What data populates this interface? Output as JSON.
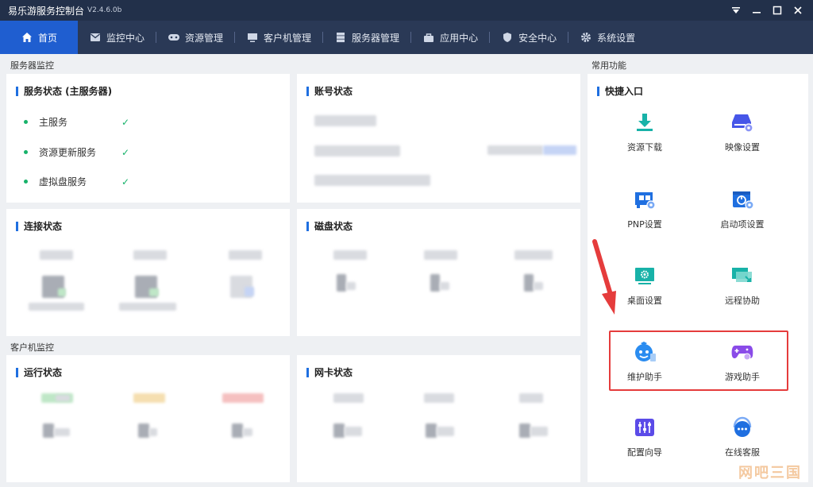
{
  "window": {
    "title": "易乐游服务控制台",
    "version": "V2.4.6.0b"
  },
  "nav": [
    {
      "label": "首页",
      "icon": "home-icon"
    },
    {
      "label": "监控中心",
      "icon": "monitor-mail-icon"
    },
    {
      "label": "资源管理",
      "icon": "gamepad-icon"
    },
    {
      "label": "客户机管理",
      "icon": "computer-icon"
    },
    {
      "label": "服务器管理",
      "icon": "server-icon"
    },
    {
      "label": "应用中心",
      "icon": "bag-icon"
    },
    {
      "label": "安全中心",
      "icon": "shield-icon"
    },
    {
      "label": "系统设置",
      "icon": "gear-icon"
    }
  ],
  "sections": {
    "server_monitor": "服务器监控",
    "client_monitor": "客户机监控",
    "common_functions": "常用功能"
  },
  "service_status": {
    "title": "服务状态 (主服务器)",
    "items": [
      {
        "label": "主服务",
        "status": "✓"
      },
      {
        "label": "资源更新服务",
        "status": "✓"
      },
      {
        "label": "虚拟盘服务",
        "status": "✓"
      }
    ]
  },
  "account_status": {
    "title": "账号状态"
  },
  "connection_status": {
    "title": "连接状态"
  },
  "disk_status": {
    "title": "磁盘状态"
  },
  "run_status": {
    "title": "运行状态"
  },
  "nic_status": {
    "title": "网卡状态"
  },
  "quick_access": {
    "title": "快捷入口",
    "items": [
      {
        "label": "资源下载",
        "icon": "download-icon",
        "color": "#18b2a8"
      },
      {
        "label": "映像设置",
        "icon": "disk-image-icon",
        "color": "#4656e8"
      },
      {
        "label": "PNP设置",
        "icon": "pnp-card-icon",
        "color": "#1f6fe0"
      },
      {
        "label": "启动项设置",
        "icon": "power-calendar-icon",
        "color": "#1f6fe0"
      },
      {
        "label": "桌面设置",
        "icon": "desktop-gear-icon",
        "color": "#18b2a8"
      },
      {
        "label": "远程协助",
        "icon": "remote-desktop-icon",
        "color": "#18b2a8"
      },
      {
        "label": "维护助手",
        "icon": "robot-assistant-icon",
        "color": "#2a8cf0"
      },
      {
        "label": "游戏助手",
        "icon": "game-controller-icon",
        "color": "#8a4be8"
      },
      {
        "label": "配置向导",
        "icon": "config-sliders-icon",
        "color": "#5b4be8"
      },
      {
        "label": "在线客服",
        "icon": "headset-chat-icon",
        "color": "#1f6fe0"
      }
    ]
  },
  "watermark": "网吧三国"
}
